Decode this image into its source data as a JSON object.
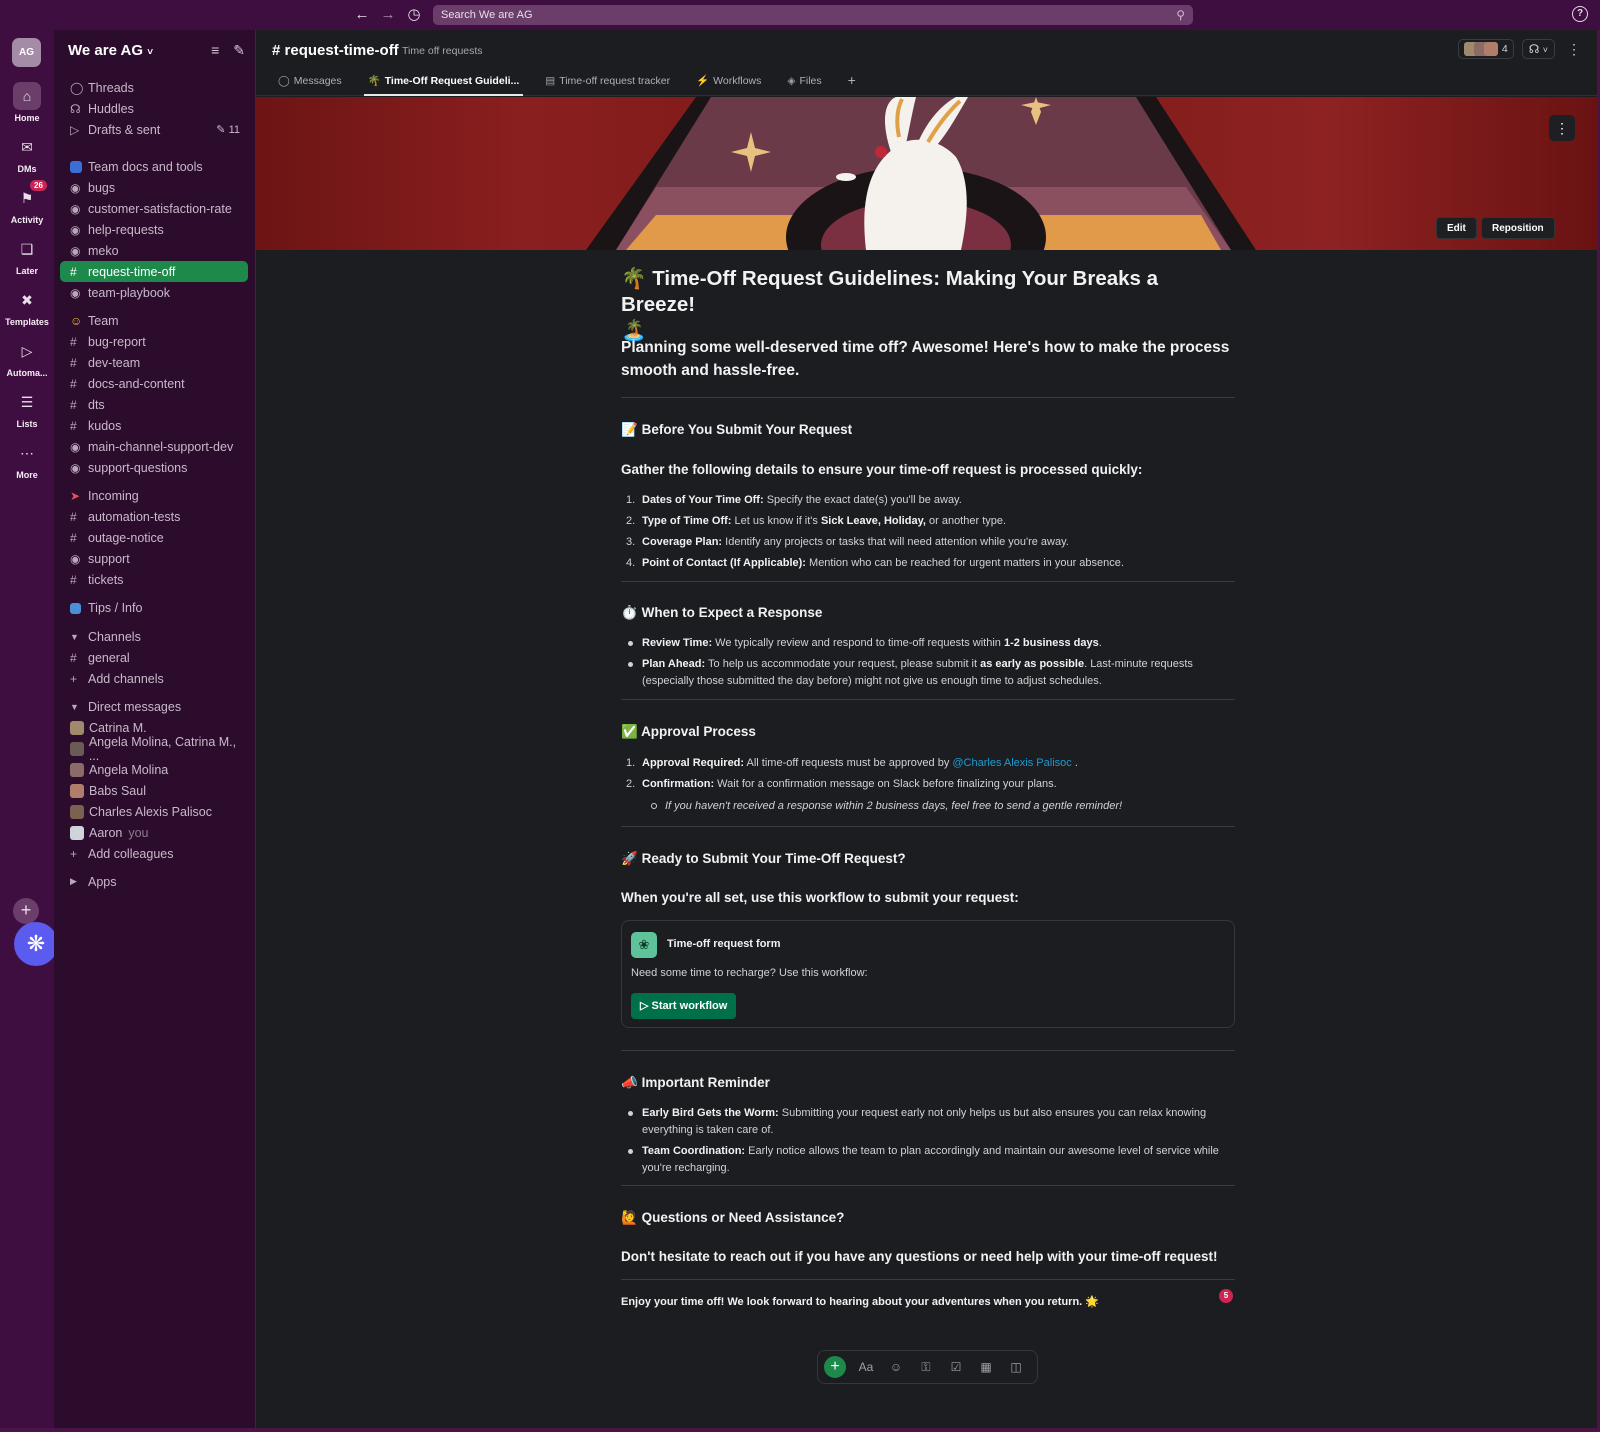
{
  "topbar": {
    "search_placeholder": "Search We are AG",
    "back_icon": "arrow-left-icon",
    "forward_icon": "arrow-right-icon",
    "history_icon": "clock-icon",
    "help_icon": "help-icon"
  },
  "rail": {
    "workspace_initials": "AG",
    "items": [
      {
        "label": "Home",
        "icon": "home-icon"
      },
      {
        "label": "DMs",
        "icon": "dms-icon"
      },
      {
        "label": "Activity",
        "icon": "bell-icon",
        "badge": "26"
      },
      {
        "label": "Later",
        "icon": "bookmark-icon"
      },
      {
        "label": "Templates",
        "icon": "templates-icon"
      },
      {
        "label": "Automa...",
        "icon": "play-icon"
      },
      {
        "label": "Lists",
        "icon": "lists-icon"
      },
      {
        "label": "More",
        "icon": "more-icon"
      }
    ]
  },
  "sidebar": {
    "workspace": "We are AG",
    "items": [
      {
        "label": "Threads",
        "icon": "threads-icon"
      },
      {
        "label": "Huddles",
        "icon": "headphones-icon"
      },
      {
        "label": "Drafts & sent",
        "icon": "send-icon",
        "count": "11"
      },
      {
        "label": "Team docs and tools",
        "icon": "docs-emoji-icon"
      },
      {
        "label": "bugs",
        "icon": "lock-icon"
      },
      {
        "label": "customer-satisfaction-rate",
        "icon": "lock-icon"
      },
      {
        "label": "help-requests",
        "icon": "lock-icon"
      },
      {
        "label": "meko",
        "icon": "lock-icon"
      },
      {
        "label": "request-time-off",
        "icon": "hash-icon",
        "active": true
      },
      {
        "label": "team-playbook",
        "icon": "lock-icon"
      },
      {
        "label": "Team",
        "icon": "smiley-emoji-icon"
      },
      {
        "label": "bug-report",
        "icon": "hash-icon"
      },
      {
        "label": "dev-team",
        "icon": "hash-icon"
      },
      {
        "label": "docs-and-content",
        "icon": "hash-icon"
      },
      {
        "label": "dts",
        "icon": "hash-icon"
      },
      {
        "label": "kudos",
        "icon": "hash-icon"
      },
      {
        "label": "main-channel-support-dev",
        "icon": "lock-icon"
      },
      {
        "label": "support-questions",
        "icon": "lock-icon"
      },
      {
        "label": "Incoming",
        "icon": "megaphone-emoji-icon"
      },
      {
        "label": "automation-tests",
        "icon": "hash-icon"
      },
      {
        "label": "outage-notice",
        "icon": "hash-icon"
      },
      {
        "label": "support",
        "icon": "lock-icon"
      },
      {
        "label": "tickets",
        "icon": "hash-icon"
      },
      {
        "label": "Tips / Info",
        "icon": "info-emoji-icon"
      },
      {
        "label": "Channels",
        "icon": "caret-down-icon"
      },
      {
        "label": "general",
        "icon": "hash-icon"
      },
      {
        "label": "Add channels",
        "icon": "plus-icon"
      },
      {
        "label": "Direct messages",
        "icon": "caret-down-icon"
      },
      {
        "label": "Catrina M.",
        "icon": "avatar"
      },
      {
        "label": "Angela Molina, Catrina M., ...",
        "icon": "group-avatar",
        "group_count": "3"
      },
      {
        "label": "Angela Molina",
        "icon": "avatar"
      },
      {
        "label": "Babs Saul",
        "icon": "avatar"
      },
      {
        "label": "Charles Alexis Palisoc",
        "icon": "avatar"
      },
      {
        "label": "Aaron",
        "icon": "avatar",
        "suffix": "you"
      },
      {
        "label": "Add colleagues",
        "icon": "plus-icon"
      },
      {
        "label": "Apps",
        "icon": "caret-right-icon"
      }
    ]
  },
  "channel": {
    "name": "# request-time-off",
    "topic": "Time off requests",
    "member_count": "4",
    "tabs": [
      {
        "label": "Messages",
        "icon": "message-icon"
      },
      {
        "label": "Time-Off Request Guideli...",
        "icon": "palm-tree-emoji-icon",
        "active": true
      },
      {
        "label": "Time-off request tracker",
        "icon": "list-icon"
      },
      {
        "label": "Workflows",
        "icon": "workflow-icon"
      },
      {
        "label": "Files",
        "icon": "files-icon"
      }
    ]
  },
  "banner": {
    "edit_label": "Edit",
    "reposition_label": "Reposition"
  },
  "doc": {
    "title_emoji": "🌴",
    "title": "Time-Off Request Guidelines: Making Your Breaks a Breeze!",
    "title_emoji2": "🏝️",
    "lead": "Planning some well-deserved time off? Awesome! Here's how to make the process smooth and hassle-free.",
    "s1_emoji": "📝",
    "s1_title": "Before You Submit Your Request",
    "s1_sub": "Gather the following details to ensure your time-off request is processed quickly:",
    "s1_items": [
      {
        "num": "1.",
        "bold": "Dates of Your Time Off:",
        "text": " Specify the exact date(s) you'll be away."
      },
      {
        "num": "2.",
        "bold": "Type of Time Off:",
        "text": " Let us know if it's ",
        "bold2": "Sick Leave, Holiday,",
        "text2": " or another type."
      },
      {
        "num": "3.",
        "bold": "Coverage Plan:",
        "text": " Identify any projects or tasks that will need attention while you're away."
      },
      {
        "num": "4.",
        "bold": "Point of Contact (If Applicable):",
        "text": " Mention who can be reached for urgent matters in your absence."
      }
    ],
    "s2_emoji": "⏱️",
    "s2_title": "When to Expect a Response",
    "s2_items": [
      {
        "bold": "Review Time:",
        "text": " We typically review and respond to time-off requests within ",
        "bold2": "1-2 business days",
        "text2": "."
      },
      {
        "bold": "Plan Ahead:",
        "text": " To help us accommodate your request, please submit it ",
        "bold2": "as early as possible",
        "text2": ". Last-minute requests (especially those submitted the day before) might not give us enough time to adjust schedules."
      }
    ],
    "s3_emoji": "✅",
    "s3_title": "Approval Process",
    "s3_items": [
      {
        "num": "1.",
        "bold": "Approval Required:",
        "text": " All time-off requests must be approved by ",
        "mention": "@Charles Alexis Palisoc",
        "text2": " ."
      },
      {
        "num": "2.",
        "bold": "Confirmation:",
        "text": " Wait for a confirmation message on Slack before finalizing your plans."
      }
    ],
    "s3_subitem": "If you haven't received a response within 2 business days, feel free to send a gentle reminder!",
    "s4_emoji": "🚀",
    "s4_title": "Ready to Submit Your Time-Off Request?",
    "s4_sub": "When you're all set, use this workflow to submit your request:",
    "workflow": {
      "icon": "leaf-icon",
      "title": "Time-off request form",
      "desc": "Need some time to recharge? Use this workflow:",
      "button": "Start workflow"
    },
    "s5_emoji": "📣",
    "s5_title": "Important Reminder",
    "s5_items": [
      {
        "bold": "Early Bird Gets the Worm:",
        "text": " Submitting your request early not only helps us but also ensures you can relax knowing everything is taken care of."
      },
      {
        "bold": "Team Coordination:",
        "text": " Early notice allows the team to plan accordingly and maintain our awesome level of service while you're recharging."
      }
    ],
    "s6_emoji": "🙋",
    "s6_title": "Questions or Need Assistance?",
    "s6_sub": "Don't hesitate to reach out if you have any questions or need help with your time-off request!",
    "closing": "Enjoy your time off! We look forward to hearing about your adventures when you return.",
    "closing_emoji": "🌟",
    "notif_count": "5"
  },
  "toolbar": {
    "items": [
      "plus-icon",
      "format-icon",
      "emoji-icon",
      "attach-icon",
      "checkbox-icon",
      "table-icon",
      "columns-icon"
    ],
    "format_label": "Aa"
  },
  "colors": {
    "aubergine": "#3f0e40",
    "sidebar": "#2b0c2c",
    "active_channel": "#1d8a4c",
    "main_bg": "#1b1d21",
    "mention": "#1d9bd1",
    "workflow_button": "#00704a"
  }
}
